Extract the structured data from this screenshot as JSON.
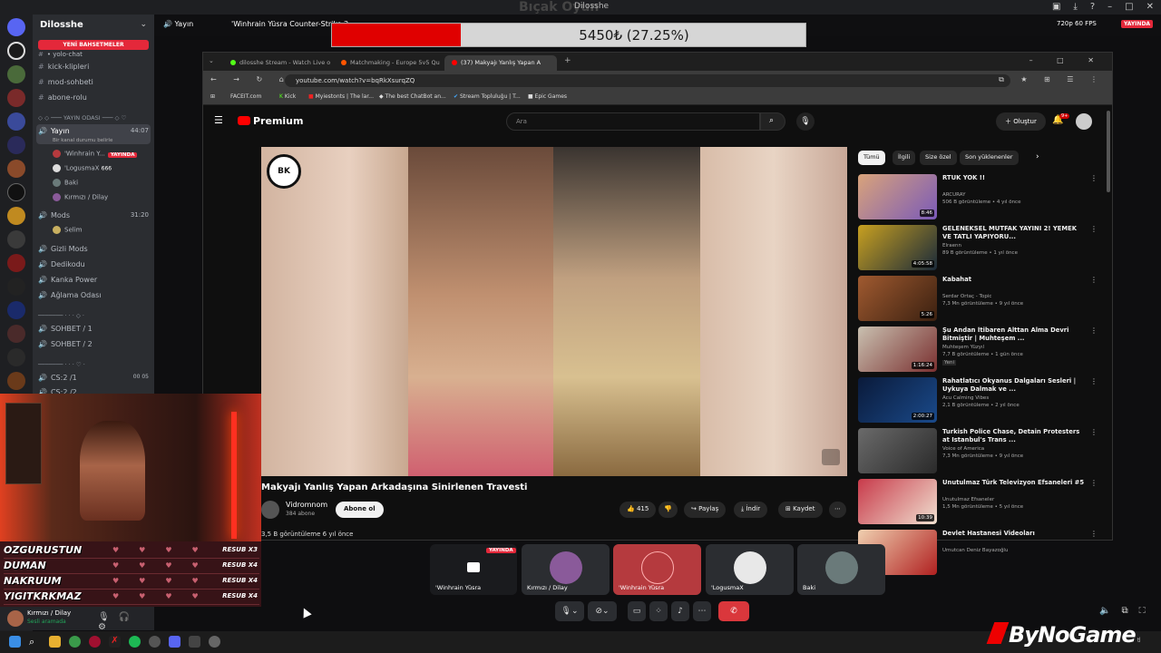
{
  "topbar": {
    "watermark": "Bıçak Oyun",
    "window_title": "Dilosshe"
  },
  "server": {
    "name": "Dilosshe",
    "promo": "YENİ BAHSETMELER",
    "text_channels": [
      "kick-klipleri",
      "mod-sohbeti",
      "abone-rolu"
    ],
    "partial_channel": "• yolo-chat",
    "cat_voice": "YAYIN ODASI",
    "live_channel": {
      "name": "Yayın",
      "timer": "44:07",
      "status": "Bir kanal durumu belirle"
    },
    "live_users": [
      {
        "name": "'Winhrain Y...",
        "badge": "YAYINDA"
      },
      {
        "name": "'LogusmaX",
        "extra": "666"
      },
      {
        "name": "Baki"
      },
      {
        "name": "Kırmızı / Dilay"
      }
    ],
    "mods_channel": {
      "name": "Mods",
      "timer": "31:20"
    },
    "mods_users": [
      {
        "name": "Selim"
      }
    ],
    "voice_channels": [
      "Gizli Mods",
      "Dedikodu",
      "Kanka Power",
      "Ağlama Odası"
    ],
    "sohbet_channels": [
      "SOHBET / 1",
      "SOHBET / 2"
    ],
    "cs_channels": [
      {
        "name": "CS:2 /1",
        "a": "00",
        "b": "05"
      },
      {
        "name": "CS:2 /2",
        "a": "00",
        "b": "05"
      }
    ]
  },
  "voicebar": {
    "channel": "Yayın",
    "title": "'Winhrain Yüsra Counter-Strike 2",
    "quality": "720p 60 FPS",
    "live": "YAYINDA"
  },
  "goal": {
    "text": "5450₺ (27.25%)",
    "fraction": 0.2725
  },
  "browser": {
    "tabs": [
      {
        "label": "dilosshe Stream - Watch Live o",
        "color": "#53fc18"
      },
      {
        "label": "Matchmaking - Europe 5v5 Qu",
        "color": "#ff5500"
      },
      {
        "label": "(37) Makyajı Yanlış Yapan A",
        "color": "#ff0000"
      }
    ],
    "url": "youtube.com/watch?v=bqRkXsurqZQ",
    "bookmarks": [
      "FACEIT.com",
      "Kick",
      "Myiestonts | The lar...",
      "The best ChatBot an...",
      "Stream Topluluğu | T...",
      "Epic Games"
    ]
  },
  "youtube": {
    "logo": "Premium",
    "search_placeholder": "Ara",
    "create": "Oluştur",
    "notif_count": "9+",
    "video_title": "Makyajı Yanlış Yapan Arkadaşına Sinirlenen Travesti",
    "channel_name": "Vidromnom",
    "channel_subs": "384 abone",
    "subscribe": "Abone ol",
    "likes": "415",
    "share": "Paylaş",
    "download": "İndir",
    "save": "Kaydet",
    "views": "3,5 B görüntüleme  6 yıl önce",
    "chips": [
      "Tümü",
      "İlgili",
      "Size özel",
      "Son yüklenenler"
    ],
    "recs": [
      {
        "title": "RTÜK YOK !!",
        "channel": "ARCURAY",
        "meta": "506 B görüntüleme • 4 yıl önce",
        "dur": "8:46",
        "c1": "#d9a37a",
        "c2": "#7a5ab8"
      },
      {
        "title": "GELENEKSEL MUTFAK YAYINI 2! YEMEK VE TATLI YAPIYORU...",
        "channel": "Elraenn",
        "meta": "89 B görüntüleme • 1 yıl önce",
        "dur": "4:05:58",
        "c1": "#c8a020",
        "c2": "#1a2a3a"
      },
      {
        "title": "Kabahat",
        "channel": "Serdar Ortaç - Topic",
        "meta": "7,3 Mn görüntüleme • 9 yıl önce",
        "dur": "5:26",
        "c1": "#a05a30",
        "c2": "#3a2010"
      },
      {
        "title": "Şu Andan İtibaren Alttan Alma Devri Bitmiştir | Muhteşem ...",
        "channel": "Muhteşem Yüzyıl",
        "meta": "7,7 B görüntüleme • 1 gün önce",
        "dur": "1:16:24",
        "badge": "Yeni",
        "c1": "#c9c0b0",
        "c2": "#7a3030"
      },
      {
        "title": "Rahatlatıcı Okyanus Dalgaları Sesleri | Uykuya Dalmak ve ...",
        "channel": "Acu Calming Vibes",
        "meta": "2,1 B görüntüleme • 2 yıl önce",
        "dur": "2:00:27",
        "c1": "#0a1a3a",
        "c2": "#1a4a8a"
      },
      {
        "title": "Turkish Police Chase, Detain Protesters at Istanbul's Trans ...",
        "channel": "Voice of America",
        "meta": "7,3 Mn görüntüleme • 9 yıl önce",
        "dur": "",
        "c1": "#6a6a6a",
        "c2": "#2a2a2a"
      },
      {
        "title": "Unutulmaz Türk Televizyon Efsaneleri #5",
        "channel": "Unutulmaz Efsaneler",
        "meta": "1,5 Mn görüntüleme • 5 yıl önce",
        "dur": "10:39",
        "c1": "#c83a4a",
        "c2": "#f0e0d0"
      },
      {
        "title": "Devlet Hastanesi Videoları",
        "channel": "Umutcan Deniz Bayazoğlu",
        "meta": "",
        "dur": "",
        "c1": "#f0d0b0",
        "c2": "#b02020"
      }
    ]
  },
  "overlay": {
    "rows": [
      {
        "name": "OZGURUSTUN",
        "tag": "RESUB X3"
      },
      {
        "name": "DUMAN",
        "tag": "RESUB X4"
      },
      {
        "name": "NAKRUUM",
        "tag": "RESUB X4"
      },
      {
        "name": "YIGITKRKMAZ",
        "tag": "RESUB X4"
      }
    ]
  },
  "userpanel": {
    "name": "Kırmızı / Dilay",
    "status": "Sesli aramada"
  },
  "participants": [
    {
      "label": "'Winhrain Yüsra",
      "live": "YAYINDA",
      "type": "screen"
    },
    {
      "label": "Kırmızı / Dilay",
      "type": "avatar",
      "color": "#8a5a9a"
    },
    {
      "label": "'Winhrain Yüsra",
      "type": "highlight",
      "color": "#b53a3e"
    },
    {
      "label": "'LogusmaX",
      "type": "avatar",
      "color": "#e8e8e8"
    },
    {
      "label": "Baki",
      "type": "avatar",
      "color": "#6a7a7a"
    }
  ],
  "brand": {
    "name": "ByNoGame",
    "sub": "tl"
  }
}
